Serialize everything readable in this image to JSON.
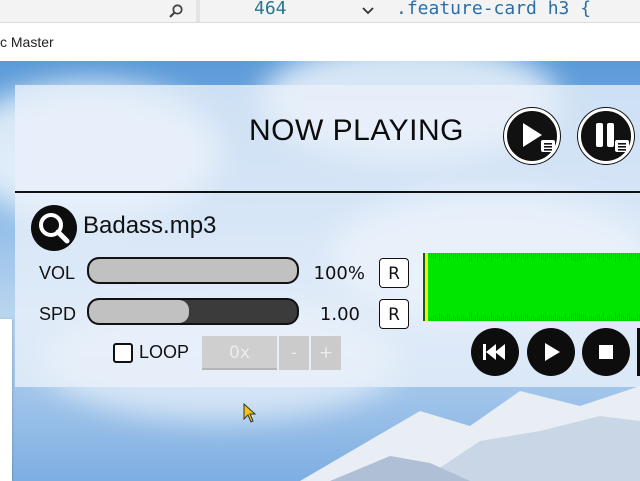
{
  "editor": {
    "line_number": "464",
    "code_snippet": ".feature-card h3 {"
  },
  "window": {
    "title": "c Master"
  },
  "player": {
    "heading": "NOW PLAYING",
    "filename": "Badass.mp3",
    "volume": {
      "label": "VOL",
      "value_text": "100%",
      "fill_fraction": 1.0,
      "reset_label": "R"
    },
    "speed": {
      "label": "SPD",
      "value_text": "1.00",
      "fill_fraction": 0.48,
      "reset_label": "R"
    },
    "loop": {
      "label": "LOOP",
      "checked": false,
      "count_text": "0x",
      "minus_label": "-",
      "plus_label": "+"
    },
    "colors": {
      "waveform": "#00e600",
      "button_bg": "#0d0d0d",
      "track": "#3b3b3b",
      "fill": "#c1c1c1"
    }
  },
  "icons": [
    "search-icon",
    "chevron-down-icon",
    "play-playlist-icon",
    "pause-playlist-icon",
    "magnifier-icon",
    "rewind-icon",
    "play-icon",
    "stop-icon",
    "mouse-cursor-icon"
  ]
}
